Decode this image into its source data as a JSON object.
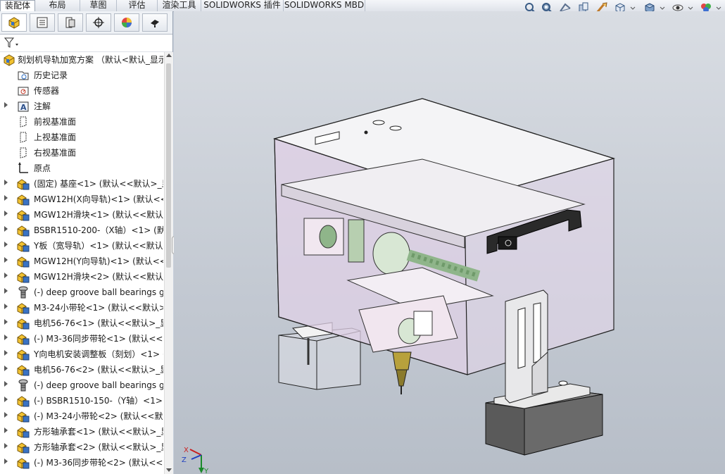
{
  "command_tabs": [
    "装配体",
    "布局",
    "草图",
    "评估",
    "渲染工具",
    "SOLIDWORKS 插件",
    "SOLIDWORKS MBD"
  ],
  "active_tab": "装配体",
  "toolbar_icons": [
    "zoom-to-fit-icon",
    "zoom-to-area-icon",
    "previous-view-icon",
    "section-view-icon",
    "dynamic-annotation-icon",
    "view-orientation-icon",
    "display-style-icon",
    "hide-show-items-icon",
    "edit-appearance-icon"
  ],
  "panel_tabs": [
    "featuremanager-icon",
    "propertymanager-icon",
    "configurationmanager-icon",
    "dimxpert-icon",
    "display-manager-icon",
    "cam-icon"
  ],
  "tree": {
    "root": "刻划机导轨加宽方案 （默认<默认_显示",
    "items": [
      {
        "label": "历史记录",
        "icon": "history-icon",
        "expandable": false
      },
      {
        "label": "传感器",
        "icon": "sensor-icon",
        "expandable": false
      },
      {
        "label": "注解",
        "icon": "annotation-icon",
        "expandable": true
      },
      {
        "label": "前视基准面",
        "icon": "plane-icon",
        "expandable": false
      },
      {
        "label": "上视基准面",
        "icon": "plane-icon",
        "expandable": false
      },
      {
        "label": "右视基准面",
        "icon": "plane-icon",
        "expandable": false
      },
      {
        "label": "原点",
        "icon": "origin-icon",
        "expandable": false
      },
      {
        "label": "(固定) 基座<1> (默认<<默认>_显",
        "icon": "part-icon",
        "expandable": true
      },
      {
        "label": "MGW12H(X向导轨)<1> (默认<<",
        "icon": "part-icon",
        "expandable": true
      },
      {
        "label": "MGW12H滑块<1> (默认<<默认>",
        "icon": "part-icon",
        "expandable": true
      },
      {
        "label": "BSBR1510-200-（X轴）<1> (默认",
        "icon": "part-icon",
        "expandable": true
      },
      {
        "label": "Y板（宽导轨）<1> (默认<<默认>",
        "icon": "part-icon",
        "expandable": true
      },
      {
        "label": "MGW12H(Y向导轨)<1> (默认<<",
        "icon": "part-icon",
        "expandable": true
      },
      {
        "label": "MGW12H滑块<2> (默认<<默认>",
        "icon": "part-icon",
        "expandable": true
      },
      {
        "label": "(-) deep groove ball bearings g",
        "icon": "toolbox-part-icon",
        "expandable": true
      },
      {
        "label": "M3-24小带轮<1> (默认<<默认>",
        "icon": "part-icon",
        "expandable": true
      },
      {
        "label": "电机56-76<1> (默认<<默认>_显",
        "icon": "part-icon",
        "expandable": true
      },
      {
        "label": "(-) M3-36同步带轮<1> (默认<<默",
        "icon": "part-icon",
        "expandable": true
      },
      {
        "label": "Y向电机安装调整板（刻划）<1> (",
        "icon": "part-icon",
        "expandable": true
      },
      {
        "label": "电机56-76<2> (默认<<默认>_显",
        "icon": "part-icon",
        "expandable": true
      },
      {
        "label": "(-) deep groove ball bearings g",
        "icon": "toolbox-part-icon",
        "expandable": true
      },
      {
        "label": "(-) BSBR1510-150-（Y轴）<1> (",
        "icon": "part-icon",
        "expandable": true
      },
      {
        "label": "(-) M3-24小带轮<2> (默认<<默认",
        "icon": "part-icon",
        "expandable": true
      },
      {
        "label": "方形轴承套<1> (默认<<默认>_显",
        "icon": "part-icon",
        "expandable": true
      },
      {
        "label": "方形轴承套<2> (默认<<默认>_显",
        "icon": "part-icon",
        "expandable": true
      },
      {
        "label": "(-) M3-36同步带轮<2> (默认<<默",
        "icon": "part-icon",
        "expandable": true
      }
    ]
  },
  "triad": {
    "x": "X",
    "y": "Y",
    "z": "Z"
  },
  "colors": {
    "enclosure": "#e8d9ec",
    "base_block": "#5a5a5a",
    "handle": "#2a2a2a",
    "screw": "#8fb58a",
    "nozzle": "#b8a13c"
  }
}
